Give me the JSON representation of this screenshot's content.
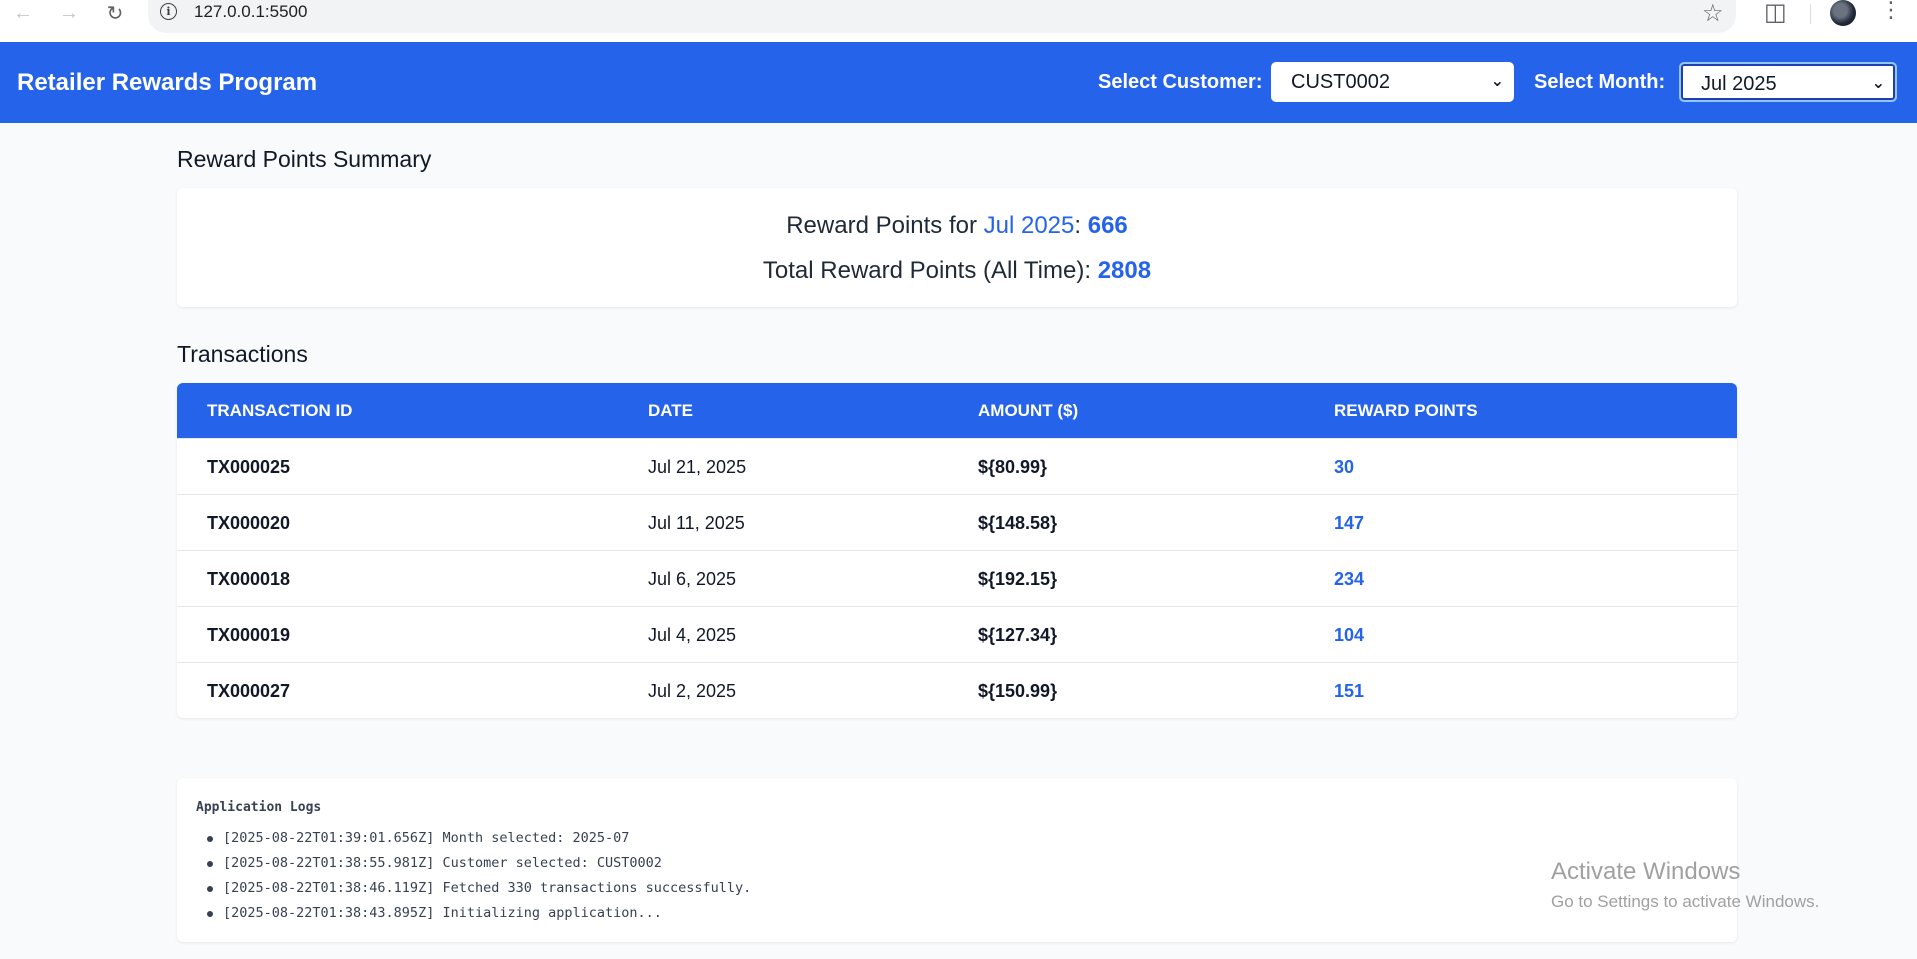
{
  "browser": {
    "url": "127.0.0.1:5500",
    "back_icon": "arrow-left-icon",
    "forward_icon": "arrow-right-icon",
    "reload_icon": "reload-icon"
  },
  "header": {
    "title": "Retailer Rewards Program",
    "customer_label": "Select Customer:",
    "customer_value": "CUST0002",
    "month_label": "Select Month:",
    "month_value": "Jul 2025",
    "background_color": "#2563eb"
  },
  "summary": {
    "section_title": "Reward Points Summary",
    "month_prefix": "Reward Points for ",
    "month": "Jul 2025",
    "month_separator": ": ",
    "month_points": "666",
    "total_prefix": "Total Reward Points (All Time): ",
    "total_points": "2808"
  },
  "transactions": {
    "section_title": "Transactions",
    "columns": [
      "TRANSACTION ID",
      "DATE",
      "AMOUNT ($)",
      "REWARD POINTS"
    ],
    "rows": [
      {
        "id": "TX000025",
        "date": "Jul 21, 2025",
        "amount": "${80.99}",
        "points": "30"
      },
      {
        "id": "TX000020",
        "date": "Jul 11, 2025",
        "amount": "${148.58}",
        "points": "147"
      },
      {
        "id": "TX000018",
        "date": "Jul 6, 2025",
        "amount": "${192.15}",
        "points": "234"
      },
      {
        "id": "TX000019",
        "date": "Jul 4, 2025",
        "amount": "${127.34}",
        "points": "104"
      },
      {
        "id": "TX000027",
        "date": "Jul 2, 2025",
        "amount": "${150.99}",
        "points": "151"
      }
    ]
  },
  "logs": {
    "title": "Application Logs",
    "entries": [
      "[2025-08-22T01:39:01.656Z] Month selected: 2025-07",
      "[2025-08-22T01:38:55.981Z] Customer selected: CUST0002",
      "[2025-08-22T01:38:46.119Z] Fetched 330 transactions successfully.",
      "[2025-08-22T01:38:43.895Z] Initializing application..."
    ]
  },
  "watermark": {
    "title": "Activate Windows",
    "subtitle": "Go to Settings to activate Windows."
  },
  "colors": {
    "accent": "#2563eb",
    "page_background": "#f8fafc"
  }
}
